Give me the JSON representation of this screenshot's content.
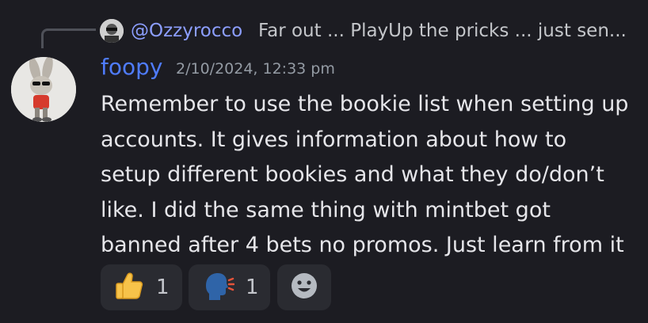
{
  "reply": {
    "username": "@Ozzyrocco",
    "preview": "Far out ... PlayUp the pricks ... just sen..."
  },
  "message": {
    "author": "foopy",
    "timestamp": "2/10/2024, 12:33 pm",
    "author_color": "#4f7cff",
    "lines": [
      "Remember to use the bookie list when setting up",
      "accounts. It gives information about how to",
      "setup different bookies and what they do/don’t",
      "like.  I did the same thing with mintbet got",
      "banned after 4 bets no promos. Just learn from it"
    ]
  },
  "reactions": [
    {
      "icon": "thumbs-up-icon",
      "count": "1"
    },
    {
      "icon": "speaking-head-icon",
      "count": "1"
    }
  ],
  "add_reaction_icon": "add-reaction-icon"
}
